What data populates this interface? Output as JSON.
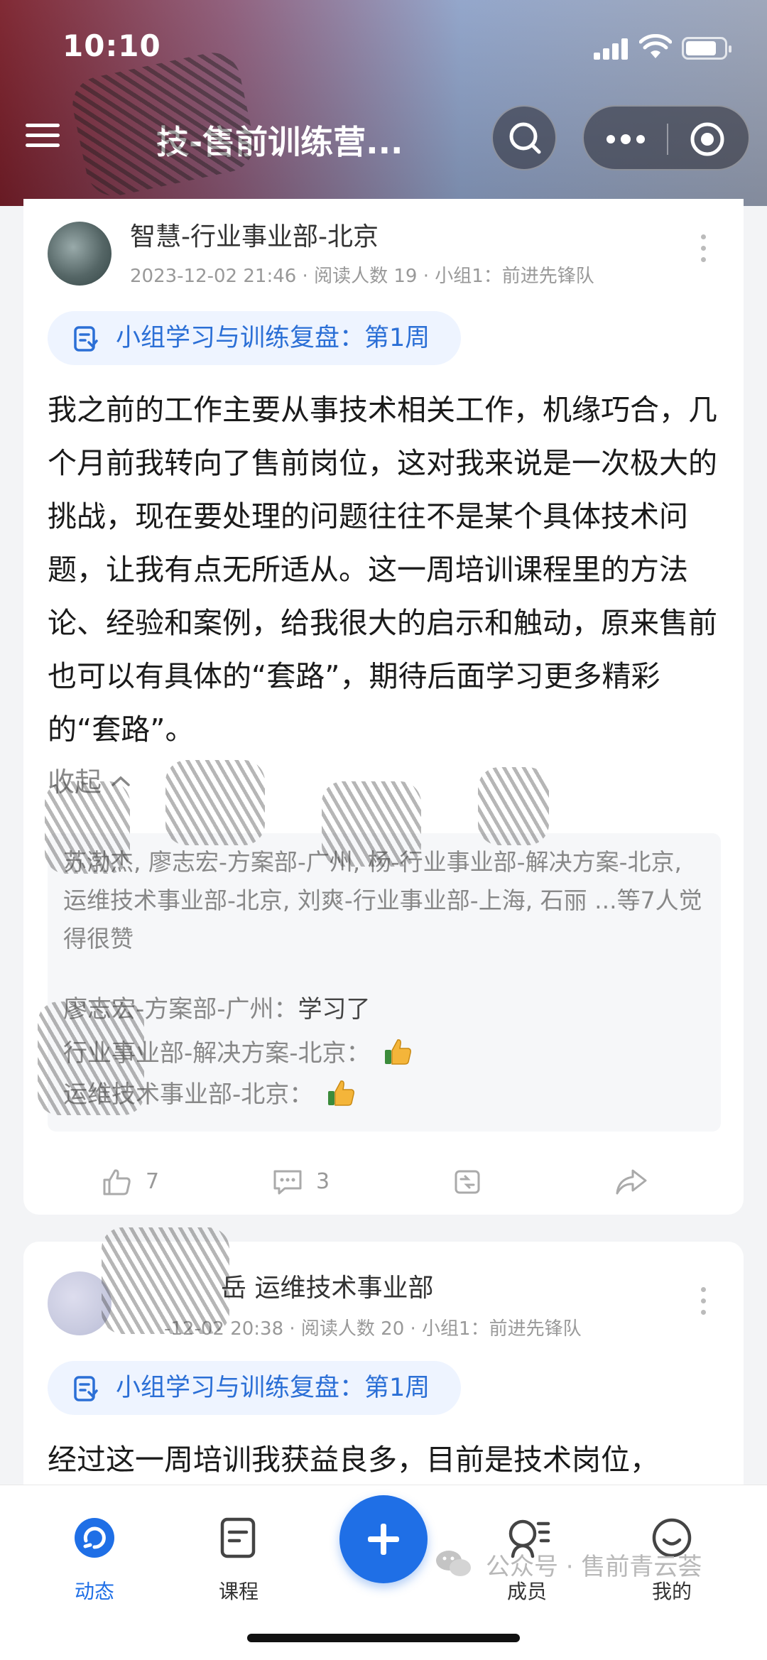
{
  "status_bar": {
    "time": "10:10"
  },
  "header": {
    "title": "技-售前训练营..."
  },
  "posts": [
    {
      "author": "智慧-行业事业部-北京",
      "meta": "2023-12-02 21:46 · 阅读人数 19 · 小组1：前进先锋队",
      "topic": "小组学习与训练复盘：第1周",
      "text": "我之前的工作主要从事技术相关工作，机缘巧合，几个月前我转向了售前岗位，这对我来说是一次极大的挑战，现在要处理的问题往往不是某个具体技术问题，让我有点无所适从。这一周培训课程里的方法论、经验和案例，给我很大的启示和触动，原来售前也可以有具体的“套路”，期待后面学习更多精彩的“套路”。",
      "collapse_label": "收起",
      "likes_text": "苏渤杰, 廖志宏-方案部-广州, 杨-行业事业部-解决方案-北京, 运维技术事业部-北京, 刘爽-行业事业部-上海, 石丽 ...等7人觉得很赞",
      "comments": [
        {
          "name": "廖志宏-方案部-广州：",
          "content": "学习了"
        },
        {
          "name": "行业事业部-解决方案-北京：",
          "content": ""
        },
        {
          "name": "运维技术事业部-北京：",
          "content": ""
        }
      ],
      "like_count": "7",
      "comment_count": "3"
    },
    {
      "author": "岳 运维技术事业部",
      "meta": "-12-02 20:38 · 阅读人数 20 · 小组1：前进先锋队",
      "topic": "小组学习与训练复盘：第1周",
      "text": "经过这一周培训我获益良多，目前是技术岗位，"
    }
  ],
  "bottom_nav": {
    "tabs": [
      {
        "label": "动态"
      },
      {
        "label": "课程"
      },
      {
        "label": "成员"
      },
      {
        "label": "我的"
      }
    ]
  },
  "watermark": "公众号 · 售前青云荟",
  "colors": {
    "accent": "#1f6fe6",
    "tag_bg": "#eef4ff",
    "tag_text": "#2b6fd6"
  }
}
